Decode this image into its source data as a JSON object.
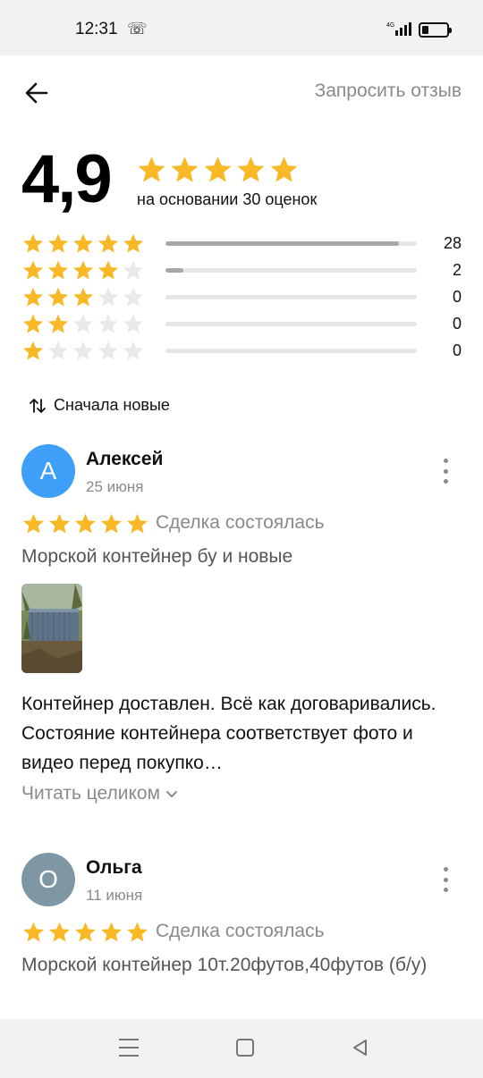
{
  "status_bar": {
    "time": "12:31",
    "call_icon": "phone-hangup-icon",
    "network": "4G",
    "signal_icon": "signal-icon",
    "battery_icon": "battery-low-icon"
  },
  "header": {
    "back_icon": "arrow-left-icon",
    "request_review_label": "Запросить отзыв"
  },
  "summary": {
    "score": "4,9",
    "stars": 5,
    "based_on": "на основании 30 оценок"
  },
  "distribution": [
    {
      "stars": 5,
      "count": "28",
      "fraction": 0.93
    },
    {
      "stars": 4,
      "count": "2",
      "fraction": 0.07
    },
    {
      "stars": 3,
      "count": "0",
      "fraction": 0
    },
    {
      "stars": 2,
      "count": "0",
      "fraction": 0
    },
    {
      "stars": 1,
      "count": "0",
      "fraction": 0
    }
  ],
  "sort": {
    "icon": "sort-arrows-icon",
    "label": "Сначала новые"
  },
  "reviews": [
    {
      "avatar_letter": "А",
      "avatar_color": "#3d9ff7",
      "name": "Алексей",
      "date": "25 июня",
      "stars": 5,
      "status": "Сделка состоялась",
      "item": "Морской контейнер бу и новые",
      "has_photo": true,
      "text": "Контейнер доставлен. Всё  как договаривались. Состояние контейнера соответствует фото и видео перед покупко…",
      "read_more": "Читать целиком"
    },
    {
      "avatar_letter": "О",
      "avatar_color": "#7f97a5",
      "name": "Ольга",
      "date": "11 июня",
      "stars": 5,
      "status": "Сделка состоялась",
      "item": "Морской контейнер 10т.20футов,40футов (б/у)"
    }
  ],
  "colors": {
    "star_filled": "#f9b825",
    "star_empty": "#e9e9e9",
    "muted_text": "#8a8a8a",
    "bar_fill": "#a8a8a8",
    "bar_track": "#e6e6e6"
  },
  "nav_bar": {
    "menu_icon": "menu-icon",
    "home_icon": "home-square-icon",
    "back_icon": "back-triangle-icon"
  }
}
